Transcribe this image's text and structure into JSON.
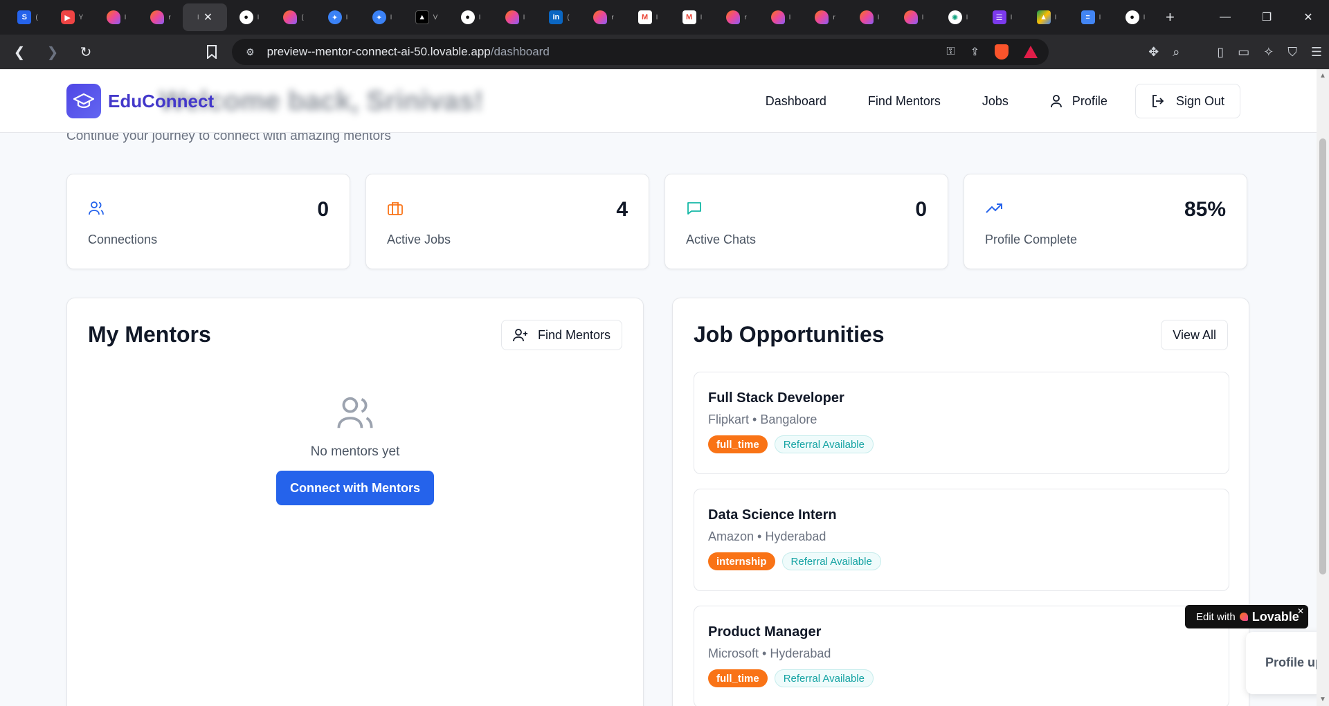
{
  "browser": {
    "tabs": [
      {
        "icon": "s-icon",
        "glyph": "S",
        "style": "blue",
        "title": "("
      },
      {
        "icon": "youtube-icon",
        "glyph": "▶",
        "style": "red",
        "title": "Y"
      },
      {
        "icon": "lovable-icon",
        "glyph": "",
        "style": "heart",
        "title": "I"
      },
      {
        "icon": "lovable-icon",
        "glyph": "",
        "style": "heart",
        "title": "r"
      },
      {
        "icon": "",
        "glyph": "",
        "style": "",
        "title": "I",
        "active": true
      },
      {
        "icon": "github-icon",
        "glyph": "●",
        "style": "gh",
        "title": "I"
      },
      {
        "icon": "lovable-icon",
        "glyph": "",
        "style": "heart",
        "title": "("
      },
      {
        "icon": "dove-icon",
        "glyph": "✦",
        "style": "dv",
        "title": "I"
      },
      {
        "icon": "dove-icon",
        "glyph": "✦",
        "style": "dv",
        "title": "I"
      },
      {
        "icon": "triangle-icon",
        "glyph": "▲",
        "style": "dark",
        "title": "V"
      },
      {
        "icon": "github-icon",
        "glyph": "●",
        "style": "gh",
        "title": "I"
      },
      {
        "icon": "lovable-icon",
        "glyph": "",
        "style": "heart",
        "title": "I"
      },
      {
        "icon": "linkedin-icon",
        "glyph": "in",
        "style": "li",
        "title": "("
      },
      {
        "icon": "lovable-icon",
        "glyph": "",
        "style": "heart",
        "title": "r"
      },
      {
        "icon": "gmail-icon",
        "glyph": "M",
        "style": "gm",
        "title": "I"
      },
      {
        "icon": "gmail-icon",
        "glyph": "M",
        "style": "gm",
        "title": "I"
      },
      {
        "icon": "lovable-icon",
        "glyph": "",
        "style": "heart",
        "title": "r"
      },
      {
        "icon": "lovable-icon",
        "glyph": "",
        "style": "heart",
        "title": "I"
      },
      {
        "icon": "lovable-icon",
        "glyph": "",
        "style": "heart",
        "title": "r"
      },
      {
        "icon": "lovable-icon",
        "glyph": "",
        "style": "heart",
        "title": "I"
      },
      {
        "icon": "lovable-icon",
        "glyph": "",
        "style": "heart",
        "title": "I"
      },
      {
        "icon": "openai-icon",
        "glyph": "✺",
        "style": "gr",
        "title": "I"
      },
      {
        "icon": "list-icon",
        "glyph": "☰",
        "style": "pur",
        "title": "I"
      },
      {
        "icon": "drive-icon",
        "glyph": "▲",
        "style": "drv",
        "title": "I"
      },
      {
        "icon": "docs-icon",
        "glyph": "≡",
        "style": "doc",
        "title": "I"
      },
      {
        "icon": "github-icon",
        "glyph": "●",
        "style": "gh",
        "title": "I"
      }
    ],
    "url_host": "preview--mentor-connect-ai-50.lovable.app",
    "url_path": "/dashboard"
  },
  "header": {
    "brand": "EduConnect",
    "welcome": "Welcome back, Srinivas!",
    "nav": {
      "dashboard": "Dashboard",
      "find_mentors": "Find Mentors",
      "jobs": "Jobs",
      "profile": "Profile",
      "sign_out": "Sign Out"
    }
  },
  "subtitle": "Continue your journey to connect with amazing mentors",
  "stats": [
    {
      "label": "Connections",
      "value": "0",
      "icon": "users-icon",
      "color": "#2563eb"
    },
    {
      "label": "Active Jobs",
      "value": "4",
      "icon": "briefcase-icon",
      "color": "#f97316"
    },
    {
      "label": "Active Chats",
      "value": "0",
      "icon": "message-icon",
      "color": "#14b8a6"
    },
    {
      "label": "Profile Complete",
      "value": "85%",
      "icon": "trending-up-icon",
      "color": "#2563eb"
    }
  ],
  "mentors": {
    "title": "My Mentors",
    "find_button": "Find Mentors",
    "empty_text": "No mentors yet",
    "connect_button": "Connect with Mentors"
  },
  "jobs": {
    "title": "Job Opportunities",
    "view_all": "View All",
    "items": [
      {
        "title": "Full Stack Developer",
        "company": "Flipkart • Bangalore",
        "type": "full_time",
        "referral": "Referral Available"
      },
      {
        "title": "Data Science Intern",
        "company": "Amazon • Hyderabad",
        "type": "internship",
        "referral": "Referral Available"
      },
      {
        "title": "Product Manager",
        "company": "Microsoft • Hyderabad",
        "type": "full_time",
        "referral": "Referral Available"
      }
    ]
  },
  "overlay": {
    "edit_with": "Edit with",
    "lovable": "Lovable",
    "profile_toast": "Profile up"
  }
}
